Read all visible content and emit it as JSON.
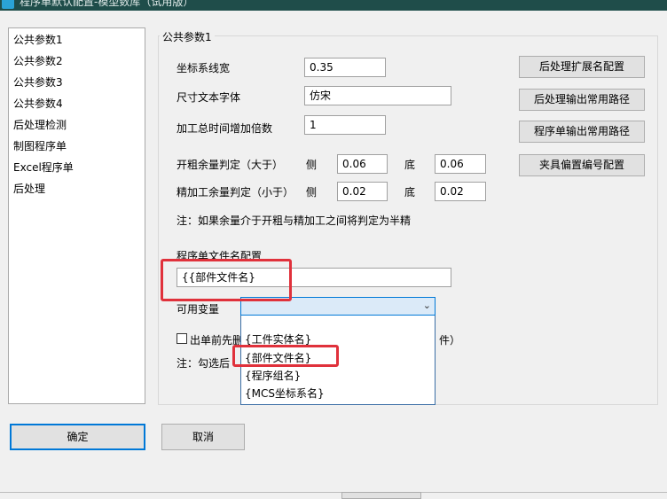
{
  "window": {
    "title": "程序单默认配置-模型数库（试用版）"
  },
  "nav": {
    "items": [
      "公共参数1",
      "公共参数2",
      "公共参数3",
      "公共参数4",
      "后处理检测",
      "制图程序单",
      "Excel程序单",
      "后处理"
    ]
  },
  "group": {
    "title": "公共参数1"
  },
  "fields": {
    "coord_line_width": {
      "label": "坐标系线宽",
      "value": "0.35"
    },
    "dim_font": {
      "label": "尺寸文本字体",
      "value": "仿宋"
    },
    "time_multiplier": {
      "label": "加工总时间增加倍数",
      "value": "1"
    },
    "rough_margin": {
      "label": "开粗余量判定（大于）",
      "side_label": "侧",
      "side_value": "0.06",
      "bottom_label": "底",
      "bottom_value": "0.06"
    },
    "finish_margin": {
      "label": "精加工余量判定（小于）",
      "side_label": "侧",
      "side_value": "0.02",
      "bottom_label": "底",
      "bottom_value": "0.02"
    },
    "note1": "注：如果余量介于开粗与精加工之间将判定为半精",
    "filename_config": {
      "label": "程序单文件名配置",
      "value": "{{部件文件名}"
    },
    "available_vars": {
      "label": "可用变量"
    },
    "checkbox": {
      "label_left": "出单前先删",
      "label_right": "件）"
    },
    "note2": "注：勾选后"
  },
  "dropdown": {
    "options": [
      "{工件实体名}",
      "{部件文件名}",
      "{程序组名}",
      "{MCS坐标系名}"
    ]
  },
  "side_buttons": {
    "post_ext": "后处理扩展名配置",
    "post_out_path": "后处理输出常用路径",
    "sheet_out_path": "程序单输出常用路径",
    "fixture_offset": "夹具偏置编号配置"
  },
  "footer": {
    "ok": "确定",
    "cancel": "取消"
  },
  "colors": {
    "highlight": "#e0313b",
    "focus": "#0078d7"
  }
}
